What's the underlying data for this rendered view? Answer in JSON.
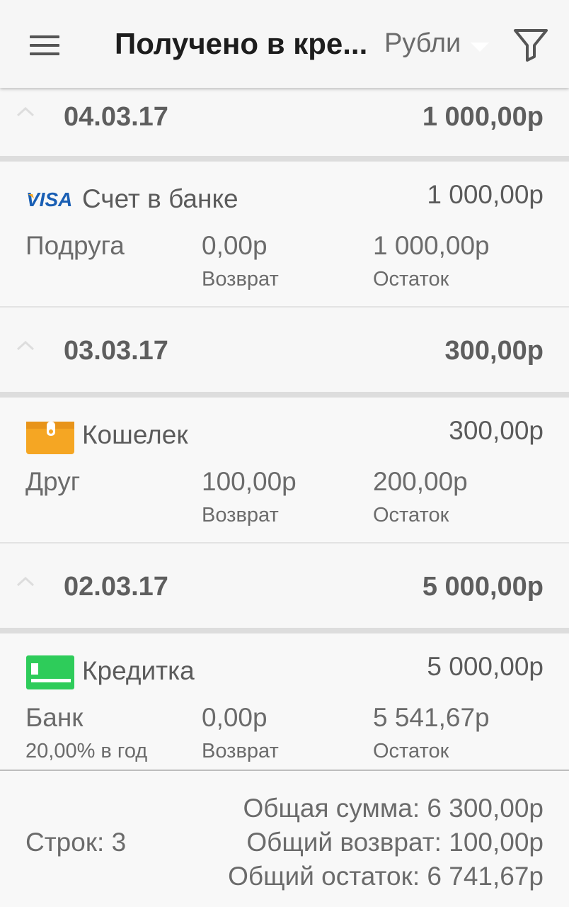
{
  "header": {
    "title": "Получено в кре...",
    "currency": "Рубли",
    "icons": [
      "menu-icon",
      "dropdown-caret-icon",
      "filter-icon"
    ]
  },
  "groups": [
    {
      "date": "04.03.17",
      "total": "1 000,00р",
      "item": {
        "account_icon": "visa-icon",
        "account": "Счет в банке",
        "amount": "1 000,00р",
        "person": "Подруга",
        "returned": "0,00р",
        "returned_label": "Возврат",
        "remaining": "1 000,00р",
        "remaining_label": "Остаток"
      }
    },
    {
      "date": "03.03.17",
      "total": "300,00р",
      "item": {
        "account_icon": "wallet-icon",
        "account": "Кошелек",
        "amount": "300,00р",
        "person": "Друг",
        "returned": "100,00р",
        "returned_label": "Возврат",
        "remaining": "200,00р",
        "remaining_label": "Остаток"
      }
    },
    {
      "date": "02.03.17",
      "total": "5 000,00р",
      "item": {
        "account_icon": "credit-card-icon",
        "account": "Кредитка",
        "amount": "5 000,00р",
        "person": "Банк",
        "rate": "20,00% в год",
        "returned": "0,00р",
        "returned_label": "Возврат",
        "remaining": "5 541,67р",
        "remaining_label": "Остаток"
      }
    }
  ],
  "footer": {
    "rows": "Строк: 3",
    "total_sum": "Общая сумма: 6 300,00р",
    "total_returned": "Общий возврат: 100,00р",
    "total_remaining": "Общий остаток: 6 741,67р"
  },
  "colors": {
    "wallet": "#f5a623",
    "card": "#2ecc5a",
    "visa_blue": "#1a5fb4",
    "visa_gold": "#f7a823"
  }
}
